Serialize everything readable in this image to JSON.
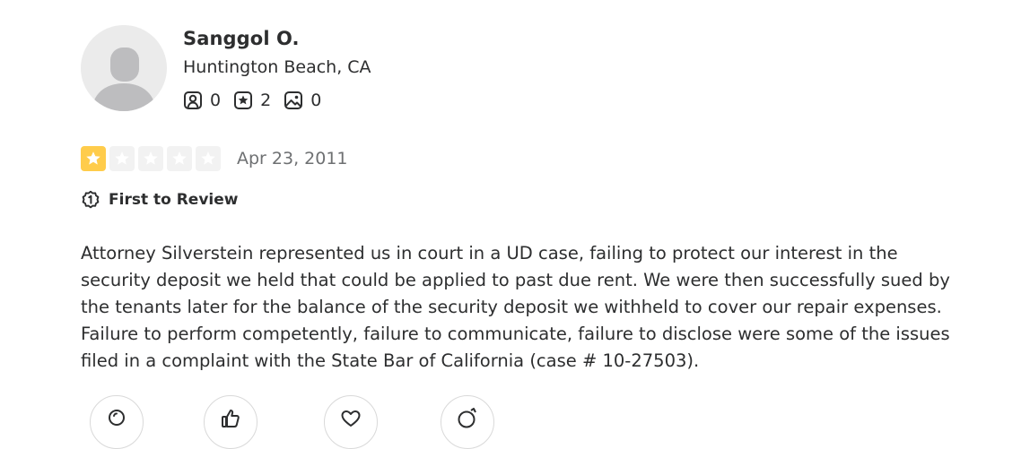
{
  "user": {
    "name": "Sanggol O.",
    "location": "Huntington Beach, CA",
    "stats": {
      "friends": "0",
      "reviews": "2",
      "photos": "0"
    }
  },
  "review": {
    "rating": 1,
    "max_rating": 5,
    "star_color": "#ffcc4b",
    "date": "Apr 23, 2011",
    "badge": "First to Review",
    "lines": [
      "Attorney Silverstein represented us in court in a UD case, failing to protect our interest in the",
      "security deposit we held that could be applied to past due rent. We were then successfully sued by",
      "the tenants later for the balance of the security deposit we withheld to cover our repair expenses.",
      "Failure to perform competently, failure to communicate, failure to disclose were some of the issues",
      "filed in a complaint with the State Bar of California (case # 10-27503)."
    ]
  },
  "reactions": [
    "lightbulb-icon",
    "thumbs-up-icon",
    "heart-icon",
    "emoji-icon"
  ]
}
